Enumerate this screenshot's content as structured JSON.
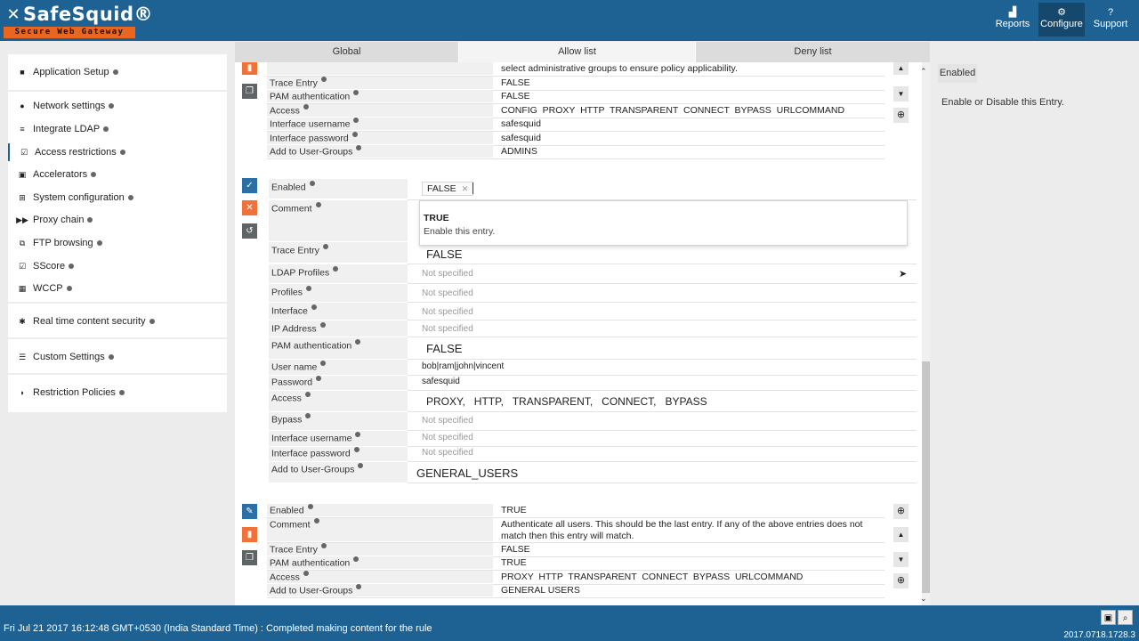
{
  "app": {
    "logo_name": "SafeSquid®",
    "logo_tagline": "Secure Web Gateway"
  },
  "topnav": [
    {
      "label": "Reports",
      "icon": "chart-icon"
    },
    {
      "label": "Configure",
      "icon": "gears-icon"
    },
    {
      "label": "Support",
      "icon": "help-icon"
    }
  ],
  "sidebar": {
    "application_setup": "Application Setup",
    "items": [
      {
        "label": "Network settings",
        "icon": "globe-icon"
      },
      {
        "label": "Integrate LDAP",
        "icon": "list-icon"
      },
      {
        "label": "Access restrictions",
        "icon": "checkbox-icon"
      },
      {
        "label": "Accelerators",
        "icon": "database-icon"
      },
      {
        "label": "System configuration",
        "icon": "sitemap-icon"
      },
      {
        "label": "Proxy chain",
        "icon": "fast-forward-icon"
      },
      {
        "label": "FTP browsing",
        "icon": "external-link-icon"
      },
      {
        "label": "SScore",
        "icon": "checkbox-icon"
      },
      {
        "label": "WCCP",
        "icon": "grid-icon"
      }
    ],
    "realtime": "Real time content security",
    "custom": "Custom Settings",
    "restriction": "Restriction Policies"
  },
  "tabs": [
    "Global",
    "Allow list",
    "Deny list"
  ],
  "entry_top": {
    "comment_tail": "select administrative groups to ensure policy applicability.",
    "trace_entry_label": "Trace Entry",
    "trace_entry": "FALSE",
    "pam_label": "PAM authentication",
    "pam": "FALSE",
    "access_label": "Access",
    "access": "CONFIG  PROXY  HTTP  TRANSPARENT  CONNECT  BYPASS  URLCOMMAND",
    "iface_user_label": "Interface username",
    "iface_user": "safesquid",
    "iface_pass_label": "Interface password",
    "iface_pass": "safesquid",
    "groups_label": "Add to User-Groups",
    "groups": "ADMINS"
  },
  "entry_edit": {
    "enabled_label": "Enabled",
    "enabled_chip": "FALSE",
    "comment_label": "Comment",
    "dropdown_title": "TRUE",
    "dropdown_desc": "Enable this entry.",
    "trace_entry_label": "Trace Entry",
    "trace_entry": "FALSE",
    "ldap_label": "LDAP Profiles",
    "ldap": "Not specified",
    "profiles_label": "Profiles",
    "profiles": "Not specified",
    "interface_label": "Interface",
    "interface": "Not specified",
    "ip_label": "IP Address",
    "ip": "Not specified",
    "pam_label": "PAM authentication",
    "pam": "FALSE",
    "user_label": "User name",
    "user": "bob|ram|john|vincent",
    "password_label": "Password",
    "password": "safesquid",
    "access_label": "Access",
    "access": "PROXY,   HTTP,   TRANSPARENT,   CONNECT,   BYPASS",
    "bypass_label": "Bypass",
    "bypass": "Not specified",
    "iface_user_label": "Interface username",
    "iface_user": "Not specified",
    "iface_pass_label": "Interface password",
    "iface_pass": "Not specified",
    "groups_label": "Add to User-Groups",
    "groups": "GENERAL_USERS"
  },
  "entry_bottom": {
    "enabled_label": "Enabled",
    "enabled": "TRUE",
    "comment_label": "Comment",
    "comment_line1": "Authenticate all users. This should be the last entry. If any of the above entries does not",
    "comment_line2": "match then this entry will match.",
    "trace_entry_label": "Trace Entry",
    "trace_entry": "FALSE",
    "pam_label": "PAM authentication",
    "pam": "TRUE",
    "access_label": "Access",
    "access": "PROXY  HTTP  TRANSPARENT  CONNECT  BYPASS  URLCOMMAND",
    "groups_label": "Add to User-Groups",
    "groups": "GENERAL USERS"
  },
  "right_panel": {
    "label": "Enabled",
    "description": "Enable or Disable this Entry."
  },
  "footer": {
    "status": "Fri Jul 21 2017 16:12:48 GMT+0530 (India Standard Time) : Completed making content for the rule",
    "version": "2017.0718.1728.3"
  },
  "colors": {
    "brand": "#1e6294",
    "accent": "#e8661f",
    "delete": "#f07238",
    "edit": "#2a6fa6"
  }
}
